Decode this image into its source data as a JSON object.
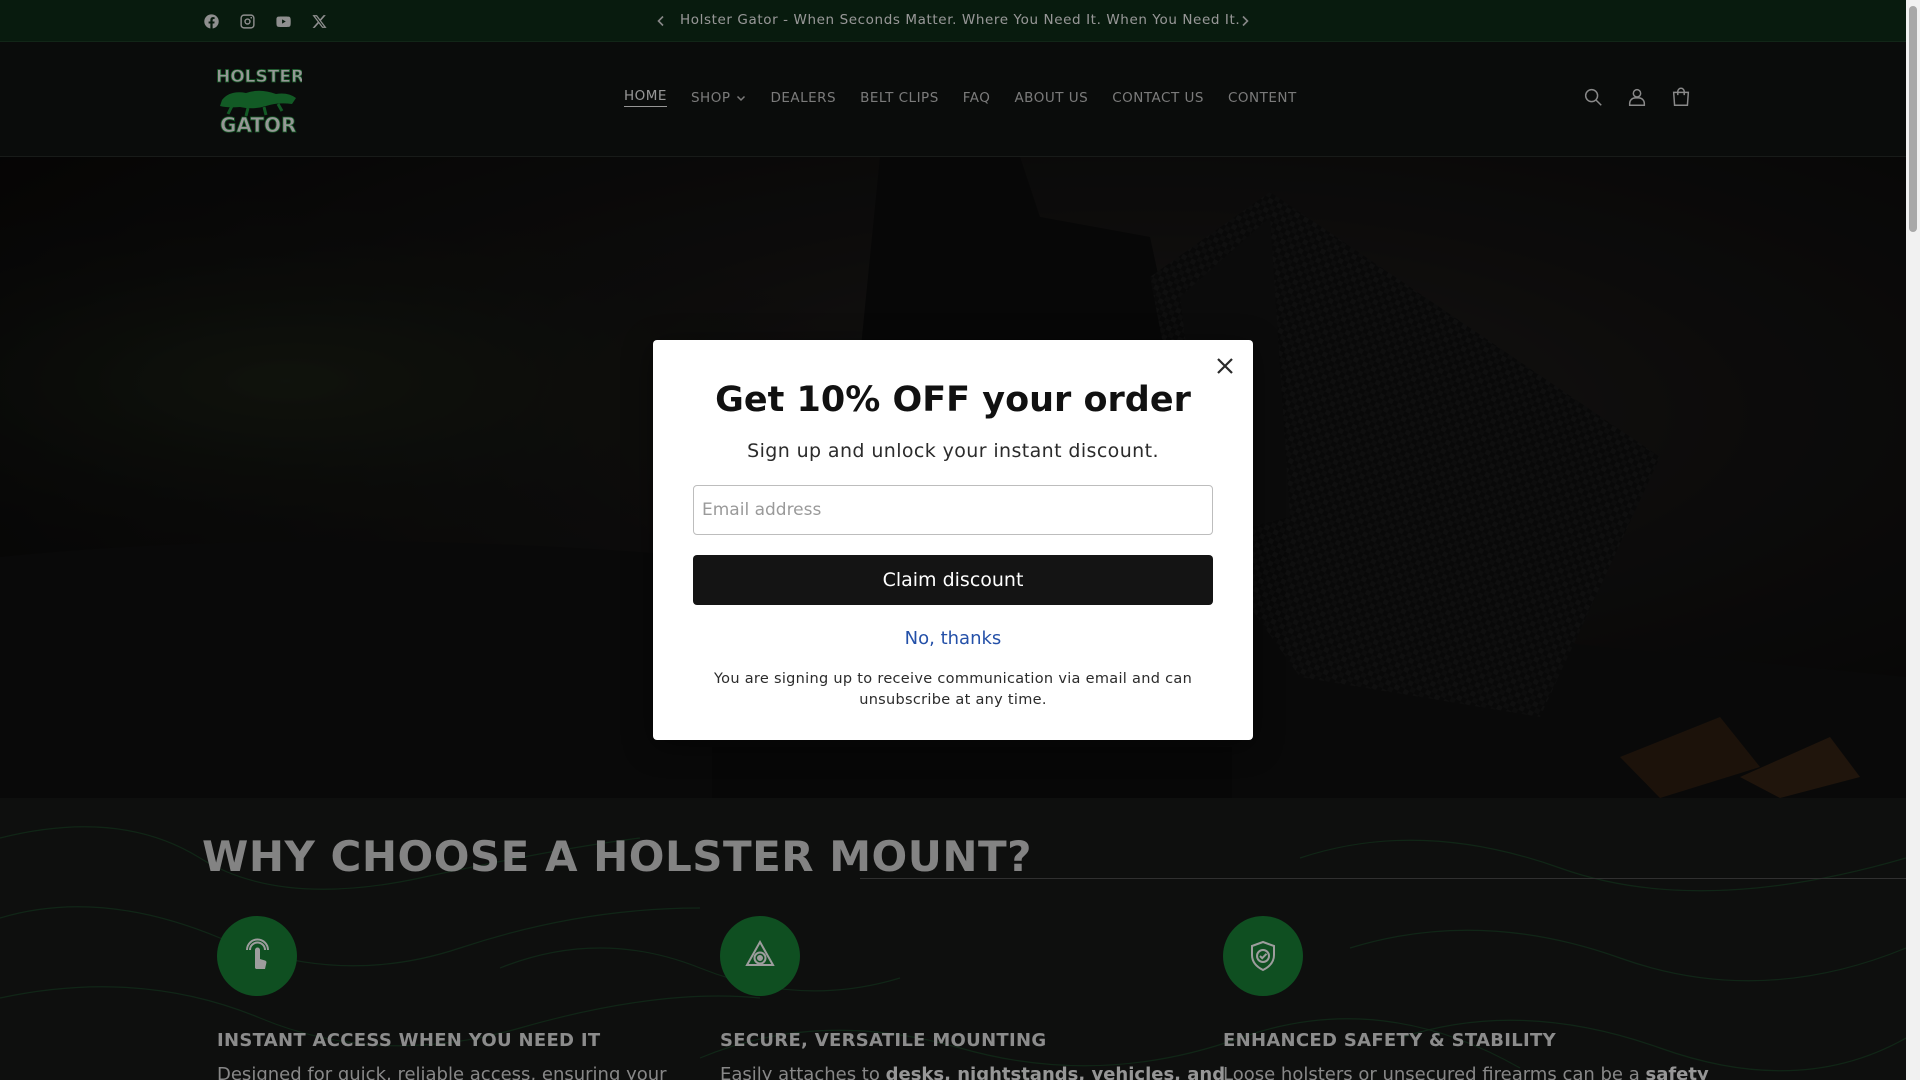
{
  "announcement": {
    "text": "Holster Gator - When Seconds Matter. Where You Need It. When You Need It.",
    "socials": [
      "facebook-icon",
      "instagram-icon",
      "youtube-icon",
      "x-icon"
    ]
  },
  "header": {
    "logo_lines": [
      "HOLSTER",
      "GATOR"
    ],
    "nav": [
      {
        "label": "HOME",
        "active": true
      },
      {
        "label": "SHOP",
        "has_dropdown": true
      },
      {
        "label": "DEALERS"
      },
      {
        "label": "BELT CLIPS"
      },
      {
        "label": "FAQ"
      },
      {
        "label": "ABOUT US"
      },
      {
        "label": "CONTACT US"
      },
      {
        "label": "CONTENT"
      }
    ],
    "icons": [
      "search-icon",
      "account-icon",
      "cart-icon"
    ]
  },
  "features": {
    "title": "WHY CHOOSE A HOLSTER MOUNT?",
    "items": [
      {
        "icon": "touch-icon",
        "heading": "INSTANT ACCESS WHEN YOU NEED IT",
        "text_plain": "Designed for quick, reliable access, ensuring your"
      },
      {
        "icon": "target-icon",
        "heading": "SECURE, VERSATILE MOUNTING",
        "text_plain": "Easily attaches to ",
        "text_bold": "desks, nightstands, vehicles, and"
      },
      {
        "icon": "shield-check-icon",
        "heading": "ENHANCED SAFETY & STABILITY",
        "text_plain": "Loose holsters or unsecured firearms can be a ",
        "text_bold": "safety"
      }
    ]
  },
  "modal": {
    "title": "Get 10% OFF your order",
    "subtitle": "Sign up and unlock your instant discount.",
    "email_placeholder": "Email address",
    "email_value": "",
    "claim_label": "Claim discount",
    "decline_label": "No, thanks",
    "legal": "You are signing up to receive communication via email and can unsubscribe at any time."
  },
  "colors": {
    "announcement_bg": "#0d2a16",
    "brand_green": "#177a34",
    "link_blue": "#2450a8"
  }
}
